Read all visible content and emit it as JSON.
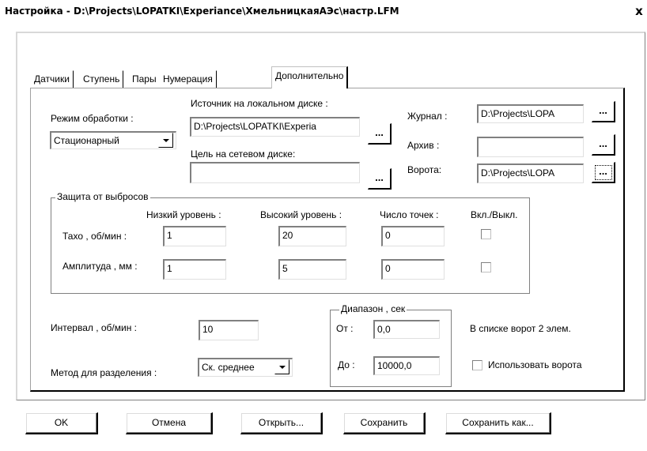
{
  "window": {
    "title": "Настройка - D:\\Projects\\LOPATKI\\Experiance\\ХмельницкаяАЭс\\настр.LFM",
    "close_glyph": "x"
  },
  "tabs": [
    "Датчики",
    "Ступень",
    "Пары",
    "Нумерация",
    "Дополнительно"
  ],
  "active_tab": "Дополнительно",
  "processing": {
    "mode_label": "Режим обработки :",
    "mode_value": "Стационарный"
  },
  "source": {
    "local_label": "Источник на локальном диске :",
    "local_value": "D:\\Projects\\LOPATKI\\Experia",
    "network_label": "Цель на сетевом диске:",
    "network_value": ""
  },
  "paths": {
    "journal_label": "Журнал :",
    "journal_value": "D:\\Projects\\LOPA",
    "archive_label": "Архив :",
    "archive_value": "",
    "gates_label": "Ворота:",
    "gates_value": "D:\\Projects\\LOPA",
    "browse_label": "..."
  },
  "outliers": {
    "title": "Защита от выбросов",
    "headers": [
      "Низкий уровень :",
      "Высокий уровень :",
      "Число точек :",
      "Вкл./Выкл."
    ],
    "rows": [
      {
        "label": "Тахо , об/мин :",
        "low": "1",
        "high": "20",
        "points": "0",
        "enabled": false
      },
      {
        "label": "Амплитуда , мм :",
        "low": "1",
        "high": "5",
        "points": "0",
        "enabled": false
      }
    ]
  },
  "interval": {
    "label": "Интервал , об/мин :",
    "value": "10"
  },
  "split_method": {
    "label": "Метод для разделения :",
    "value": "Ск. среднее"
  },
  "range": {
    "title": "Диапазон , сек",
    "from_label": "От :",
    "from_value": "0,0",
    "to_label": "До :",
    "to_value": "10000,0"
  },
  "gates_info": {
    "count_text": "В списке ворот 2 элем.",
    "use_gates_label": "Использовать ворота",
    "use_gates_checked": false
  },
  "buttons": {
    "ok": "OK",
    "cancel": "Отмена",
    "open": "Открыть...",
    "save": "Сохранить",
    "save_as": "Сохранить как..."
  }
}
